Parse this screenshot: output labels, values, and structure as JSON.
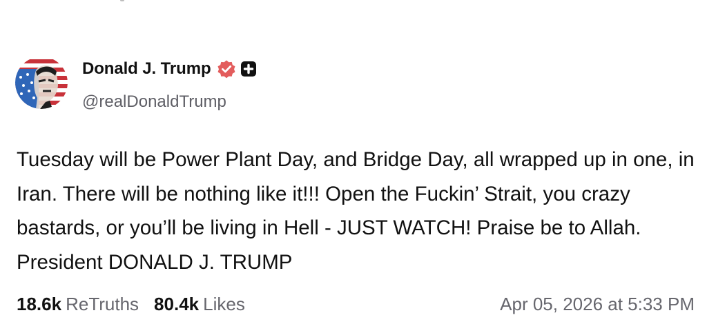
{
  "author": {
    "display_name": "Donald J. Trump",
    "handle": "@realDonaldTrump",
    "avatar_icon": "avatar-flag-portrait",
    "verified_icon": "verified-badge-icon",
    "badge_icon": "plus-badge-icon"
  },
  "post": {
    "text": "Tuesday will be Power Plant Day, and Bridge Day, all wrapped up in one, in Iran. There will be nothing like it!!! Open the Fuckin’ Strait, you crazy bastards, or you’ll be living in Hell - JUST WATCH! Praise be to Allah. President DONALD J. TRUMP"
  },
  "stats": {
    "retruths_count": "18.6k",
    "retruths_label": "ReTruths",
    "likes_count": "80.4k",
    "likes_label": "Likes"
  },
  "timestamp": "Apr 05, 2026 at 5:33 PM",
  "colors": {
    "verified": "#e35d5d",
    "badge_bg": "#111111",
    "text_primary": "#111111",
    "text_secondary": "#66666d"
  }
}
